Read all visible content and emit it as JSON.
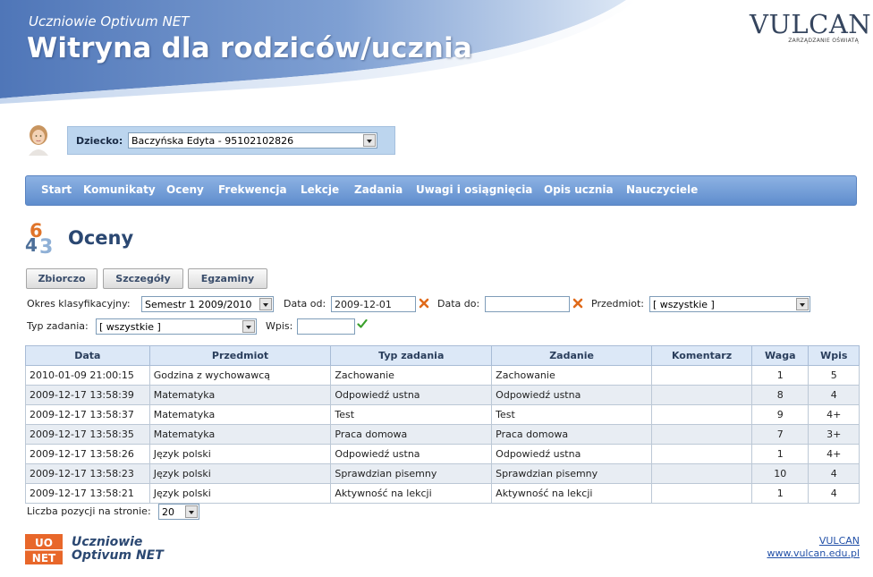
{
  "header": {
    "subtitle": "Uczniowie Optivum NET",
    "title": "Witryna dla rodziców/ucznia",
    "brand": "VULCAN",
    "brand_tagline": "ZARZĄDZANIE OŚWIATĄ"
  },
  "child": {
    "label": "Dziecko:",
    "selected": "Baczyńska Edyta - 95102102826"
  },
  "menu": [
    "Start",
    "Komunikaty",
    "Oceny",
    "Frekwencja",
    "Lekcje",
    "Zadania",
    "Uwagi i osiągnięcia",
    "Opis ucznia",
    "Nauczyciele"
  ],
  "page": {
    "title": "Oceny",
    "icon": "grades-icon"
  },
  "view_buttons": [
    "Zbiorczo",
    "Szczegóły",
    "Egzaminy"
  ],
  "filters": {
    "period_label": "Okres klasyfikacyjny:",
    "period_value": "Semestr 1 2009/2010",
    "date_from_label": "Data od:",
    "date_from_value": "2009-12-01",
    "date_to_label": "Data do:",
    "date_to_value": "",
    "subject_label": "Przedmiot:",
    "subject_value": "[ wszystkie ]",
    "task_type_label": "Typ zadania:",
    "task_type_value": "[ wszystkie ]",
    "grade_label": "Wpis:",
    "grade_value": ""
  },
  "table": {
    "columns": [
      "Data",
      "Przedmiot",
      "Typ zadania",
      "Zadanie",
      "Komentarz",
      "Waga",
      "Wpis"
    ],
    "rows": [
      [
        "2010-01-09 21:00:15",
        "Godzina z wychowawcą",
        "Zachowanie",
        "Zachowanie",
        "",
        "1",
        "5"
      ],
      [
        "2009-12-17 13:58:39",
        "Matematyka",
        "Odpowiedź ustna",
        "Odpowiedź ustna",
        "",
        "8",
        "4"
      ],
      [
        "2009-12-17 13:58:37",
        "Matematyka",
        "Test",
        "Test",
        "",
        "9",
        "4+"
      ],
      [
        "2009-12-17 13:58:35",
        "Matematyka",
        "Praca domowa",
        "Praca domowa",
        "",
        "7",
        "3+"
      ],
      [
        "2009-12-17 13:58:26",
        "Język polski",
        "Odpowiedź ustna",
        "Odpowiedź ustna",
        "",
        "1",
        "4+"
      ],
      [
        "2009-12-17 13:58:23",
        "Język polski",
        "Sprawdzian pisemny",
        "Sprawdzian pisemny",
        "",
        "10",
        "4"
      ],
      [
        "2009-12-17 13:58:21",
        "Język polski",
        "Aktywność na lekcji",
        "Aktywność na lekcji",
        "",
        "1",
        "4"
      ]
    ]
  },
  "pagination": {
    "label": "Liczba pozycji na stronie:",
    "value": "20"
  },
  "footer": {
    "logo_badge_top": "UO",
    "logo_badge_bottom": "NET",
    "logo_line1": "Uczniowie",
    "logo_line2": "Optivum NET",
    "link1": "VULCAN",
    "link2": "www.vulcan.edu.pl"
  },
  "colors": {
    "menu": "#6f9bd6",
    "header_blue": "#5a84c4",
    "clear_icon": "#e06a1a",
    "confirm_icon": "#3aa02c"
  }
}
